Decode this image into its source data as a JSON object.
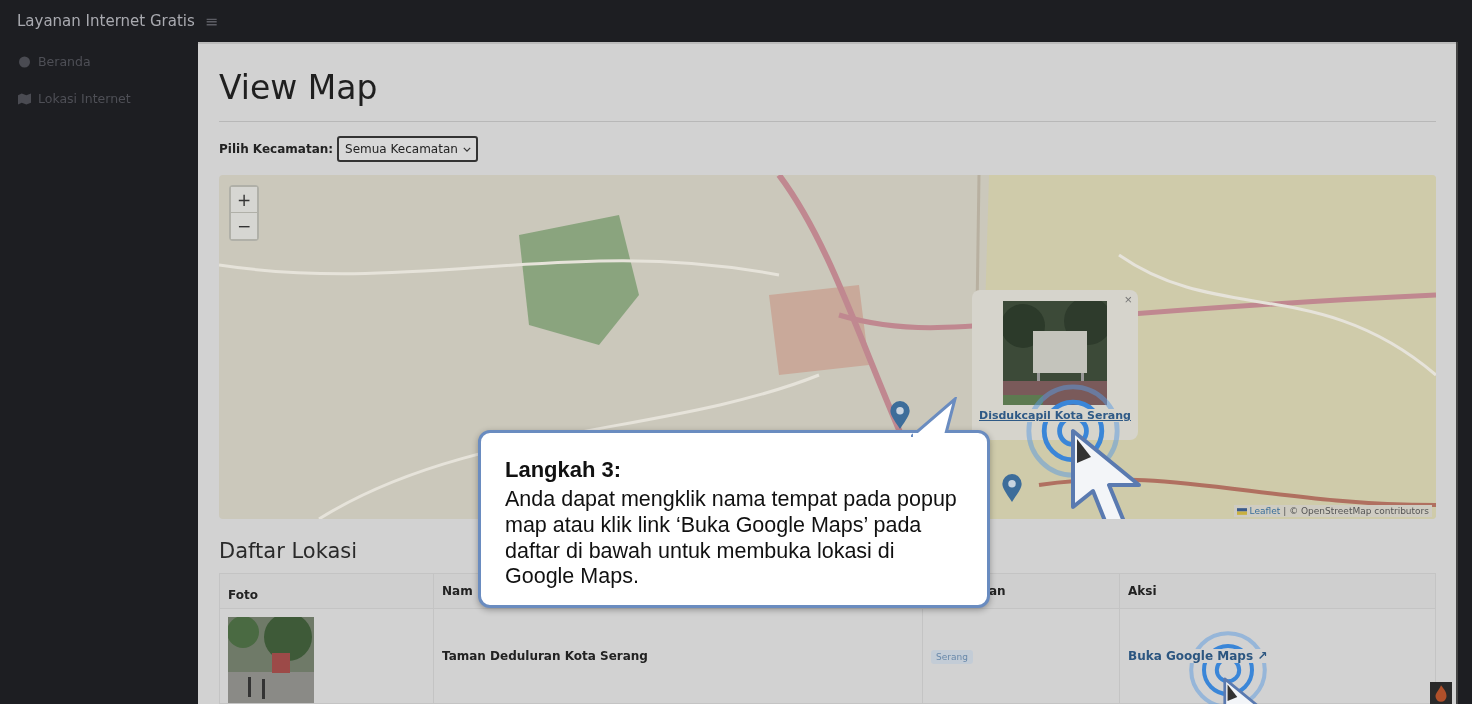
{
  "app": {
    "title": "Layanan Internet Gratis",
    "menu_icon": "≡"
  },
  "sidebar": {
    "items": [
      {
        "label": "Beranda",
        "selected": false
      },
      {
        "label": "Lokasi Internet",
        "selected": false
      }
    ]
  },
  "page": {
    "title": "View Map"
  },
  "filter": {
    "label": "Pilih Kecamatan:",
    "value": "Semua Kecamatan"
  },
  "map": {
    "zoom_in": "+",
    "zoom_out": "−",
    "popup": {
      "close": "×",
      "link": "Disdukcapil Kota Serang"
    },
    "attribution": {
      "link": "Leaflet",
      "text": "| © OpenStreetMap contributors"
    }
  },
  "list": {
    "title": "Daftar Lokasi",
    "columns": [
      "Foto",
      "Nam",
      "an",
      "Aksi"
    ],
    "rows": [
      {
        "name": "Taman Deduluran Kota Serang",
        "area": "Serang",
        "action": "Buka Google Maps ↗"
      }
    ]
  },
  "callout": {
    "title": "Langkah 3:",
    "text": "Anda dapat mengklik nama tempat pada popup map atau klik link ‘Buka Google Maps’ pada daftar di bawah untuk membuka lokasi di Google Maps."
  }
}
